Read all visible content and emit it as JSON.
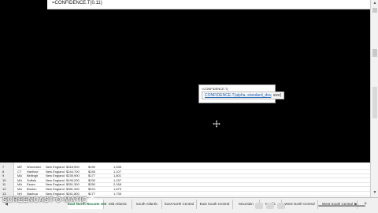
{
  "formula_bar": {
    "text": "=CONFIDENCE.T(0.11)",
    "expand_glyph": "v"
  },
  "popup": {
    "formula": "=CONFIDENCE.T(",
    "tooltip_func": "CONFIDENCE.T(alpha, standard_dev",
    "tooltip_rest": ", size)"
  },
  "sheet": {
    "rows": [
      {
        "num": "7",
        "state": "ME",
        "city": "Worcester",
        "region": "New England",
        "v1": "$318,900",
        "v2": "$190",
        "v3": "1,536"
      },
      {
        "num": "8",
        "state": "CT",
        "city": "Hartford",
        "region": "New England",
        "v1": "$244,700",
        "v2": "$245",
        "v3": "1,107"
      },
      {
        "num": "9",
        "state": "MA",
        "city": "Bellingh",
        "region": "New England",
        "v1": "$239,900",
        "v2": "$177",
        "v3": "1,801"
      },
      {
        "num": "10",
        "state": "MA",
        "city": "Suffolk",
        "region": "New England",
        "v1": "$195,200",
        "v2": "$230",
        "v3": "1,157"
      },
      {
        "num": "11",
        "state": "MA",
        "city": "Essex",
        "region": "New England",
        "v1": "$351,300",
        "v2": "$250",
        "v3": "2,168"
      },
      {
        "num": "12",
        "state": "MA",
        "city": "Boston",
        "region": "New England",
        "v1": "$381,300",
        "v2": "$224",
        "v3": "1,879"
      },
      {
        "num": "13",
        "state": "NH",
        "city": "Nashua",
        "region": "New England",
        "v1": "$261,800",
        "v2": "$177",
        "v3": "1,735"
      }
    ]
  },
  "tabs": {
    "items": [
      {
        "label": "East North Remote 103",
        "active": true
      },
      {
        "label": "Mid Atlantic"
      },
      {
        "label": "South Atlantic"
      },
      {
        "label": "East North Central"
      },
      {
        "label": "East South Central"
      },
      {
        "label": "Mountain"
      },
      {
        "label": "Pacific"
      },
      {
        "label": "West North Central"
      },
      {
        "label": "West South Central"
      }
    ],
    "nav_prev": "◀",
    "nav_next": "▶",
    "add": "+"
  },
  "watermark": {
    "text": "SCREENCAST-O-MATIC"
  },
  "icons": {
    "cursor": "move-cursor-icon",
    "scroll_up": "▲",
    "scroll_down": "▼"
  }
}
